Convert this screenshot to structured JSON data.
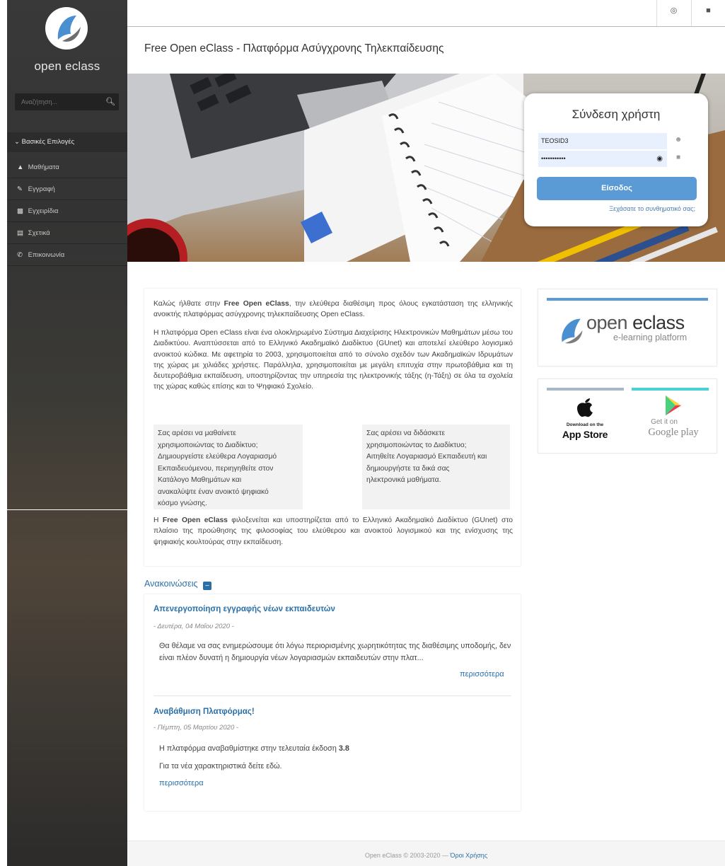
{
  "sidebar": {
    "logo_text": "open eclass",
    "search_placeholder": "Αναζήτηση...",
    "menu_header": "Βασικές Επιλογές",
    "items": [
      {
        "label": "Μαθήματα",
        "icon": "graduation-cap-icon"
      },
      {
        "label": "Εγγραφή",
        "icon": "pencil-icon"
      },
      {
        "label": "Εγχειρίδια",
        "icon": "file-icon"
      },
      {
        "label": "Σχετικά",
        "icon": "card-icon"
      },
      {
        "label": "Επικοινωνία",
        "icon": "phone-icon"
      }
    ]
  },
  "header": {
    "title": "Free Open eClass - Πλατφόρμα Ασύγχρονης Τηλεκπαίδευσης"
  },
  "login": {
    "title": "Σύνδεση χρήστη",
    "username": "TEOSID3",
    "password_masked": "•••••••••••",
    "button": "Είσοδος",
    "forgot": "Ξεχάσατε το συνθηματικό σας;"
  },
  "intro": {
    "p1_prefix": "Καλώς ήλθατε στην ",
    "p1_bold": "Free Open eClass",
    "p1_suffix": ", την ελεύθερα διαθέσιμη προς όλους εγκατάσταση της ελληνικής ανοικτής πλατφόρμας ασύγχρονης τηλεκπαίδευσης Open eClass.",
    "p2": "Η πλατφόρμα Open eClass είναι ένα ολοκληρωμένο Σύστημα Διαχείρισης Ηλεκτρονικών Μαθημάτων μέσω του Διαδικτύου. Αναπτύσσεται από το Ελληνικό Ακαδημαϊκό Διαδίκτυο (GUnet) και αποτελεί ελεύθερο λογισμικό ανοικτού κώδικα. Με αφετηρία το 2003, χρησιμοποιείται από το σύνολο σχεδόν των Ακαδημαϊκών Ιδρυμάτων της χώρας με χιλιάδες χρήστες. Παράλληλα, χρησιμοποιείται με μεγάλη επιτυχία στην πρωτοβάθμια και τη δευτεροβάθμια εκπαίδευση, υποστηρίζοντας την υπηρεσία της ηλεκτρονικής τάξης (η-Τάξη) σε όλα τα σχολεία της χώρας καθώς επίσης και το Ψηφιακό Σχολείο.",
    "box_learn": [
      "Σας αρέσει να μαθαίνετε",
      "χρησιμοποιώντας το Διαδίκτυο;",
      "Δημιουργείστε ελεύθερα Λογαριασμό",
      "Εκπαιδευόμενου, περιηγηθείτε στον",
      "Κατάλογο Μαθημάτων και",
      "ανακαλύψτε έναν ανοικτό ψηφιακό",
      "κόσμο γνώσης."
    ],
    "box_teach": [
      "Σας αρέσει να διδάσκετε",
      "χρησιμοποιώντας το Διαδίκτυο;",
      "Αιτηθείτε Λογαριασμό Εκπαιδευτή και",
      "δημιουργήστε τα δικά σας",
      "ηλεκτρονικά μαθήματα."
    ],
    "p3_prefix": "Η ",
    "p3_bold": "Free Open eClass",
    "p3_suffix": " φιλοξενείται και υποστηρίζεται από το Ελληνικό Ακαδημαϊκό Διαδίκτυο (GUnet) στο πλαίσιο της προώθησης της φιλοσοφίας του ελεύθερου και ανοικτού λογισμικού και της ενίσχυσης της ψηφιακής κουλτούρας στην εκπαίδευση."
  },
  "brand": {
    "name_open": "open",
    "name_eclass": "eclass",
    "tagline": "e-learning platform"
  },
  "apps": {
    "appstore_small": "Download on the",
    "appstore_big": "App Store",
    "gplay_small": "Get it on",
    "gplay_big": "Google play"
  },
  "announcements": {
    "title": "Ανακοινώσεις",
    "items": [
      {
        "title": "Απενεργοποίηση εγγραφής νέων εκπαιδευτών",
        "date": "- Δευτέρα, 04 Μαΐου 2020 -",
        "body": "Θα θέλαμε να σας ενημερώσουμε ότι λόγω περιορισμένης χωρητικότητας της διαθέσιμης υποδομής, δεν είναι πλέον δυνατή η δημιουργία νέων λογαριασμών εκπαιδευτών στην πλατ...",
        "more": "περισσότερα"
      },
      {
        "title": "Αναβάθμιση Πλατφόρμας!",
        "date": "- Πέμπτη, 05 Μαρτίου 2020 -",
        "body_prefix": "Η πλατφόρμα αναβαθμίστηκε στην τελευταία έκδοση ",
        "body_bold": "3.8",
        "body2": "Για τα νέα χαρακτηριστικά δείτε εδώ.",
        "more": "περισσότερα"
      }
    ]
  },
  "footer": {
    "text": "Open eClass © 2003-2020 — ",
    "link": "Όροι Χρήσης"
  },
  "colors": {
    "accent": "#5b9bd5",
    "link": "#2a6fa8",
    "sidebar": "#3a3a3a"
  }
}
